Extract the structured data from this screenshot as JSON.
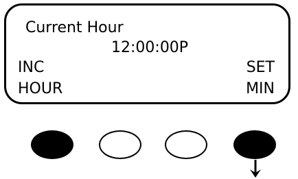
{
  "display": {
    "title": "Current Hour",
    "time_value": "12:00:00P",
    "left_softkey": {
      "line1": "INC",
      "line2": "HOUR"
    },
    "right_softkey": {
      "line1": "SET",
      "line2": "MIN"
    }
  },
  "buttons": [
    {
      "id": "softkey-1",
      "state": "active"
    },
    {
      "id": "softkey-2",
      "state": "inactive"
    },
    {
      "id": "softkey-3",
      "state": "inactive"
    },
    {
      "id": "softkey-4",
      "state": "active",
      "pointer": "down-arrow-icon"
    }
  ],
  "colors": {
    "ink": "#000000",
    "background": "#ffffff"
  }
}
